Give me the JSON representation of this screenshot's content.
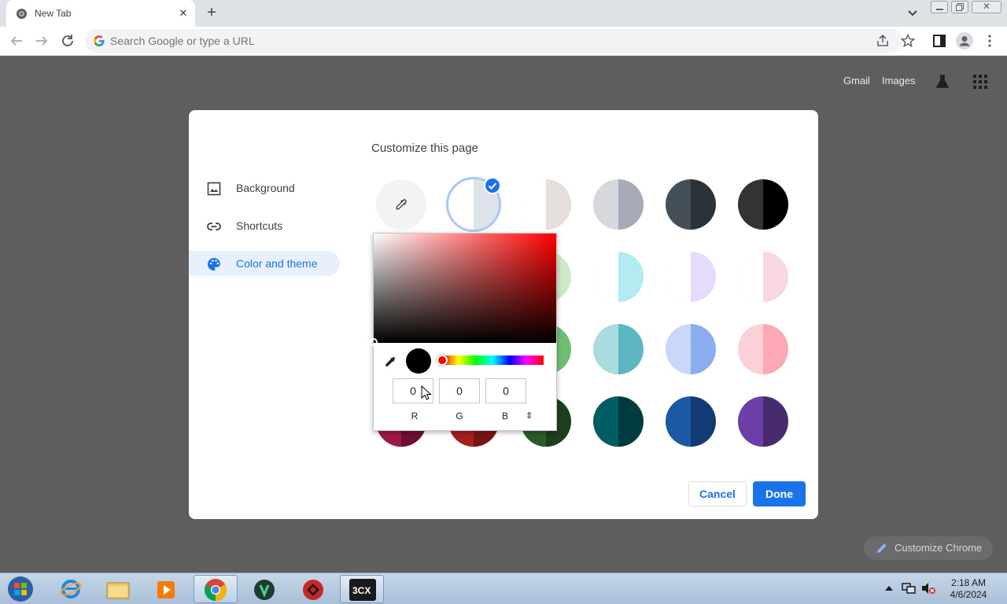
{
  "browser": {
    "tab_title": "New Tab",
    "omnibox_placeholder": "Search Google or type a URL"
  },
  "ntp": {
    "links": [
      "Gmail",
      "Images"
    ],
    "customize_chrome_label": "Customize Chrome"
  },
  "dialog": {
    "title": "Customize this page",
    "menu": [
      {
        "label": "Background",
        "icon": "image-icon"
      },
      {
        "label": "Shortcuts",
        "icon": "link-icon"
      },
      {
        "label": "Color and theme",
        "icon": "palette-icon",
        "selected": true
      }
    ],
    "swatches": [
      {
        "l": "#f1f3f4",
        "r": "#f1f3f4",
        "icon": "eyedropper-icon"
      },
      {
        "l": "#ffffff",
        "r": "#dee3e8",
        "selected": true
      },
      {
        "l": "#ffffff",
        "r": "#e6dedb"
      },
      {
        "l": "#d6d8dd",
        "r": "#a6abb7"
      },
      {
        "l": "#454f58",
        "r": "#2b3338"
      },
      {
        "l": "#333333",
        "r": "#000000"
      },
      {
        "l": "#ffffff",
        "r": "#cfe8c8"
      },
      {
        "l": "#ffffff",
        "r": "#cfe8c8"
      },
      {
        "l": "#ffffff",
        "r": "#cfe8c8"
      },
      {
        "l": "#ffffff",
        "r": "#b2ebf2"
      },
      {
        "l": "#ffffff",
        "r": "#e7dbfb"
      },
      {
        "l": "#ffffff",
        "r": "#f8d6e3"
      },
      {
        "l": "#fcc9d3",
        "r": "#ff9aa9"
      },
      {
        "l": "#f0b1ae",
        "r": "#e57373"
      },
      {
        "l": "#a6d9a2",
        "r": "#6fbf73"
      },
      {
        "l": "#a8dcde",
        "r": "#5cb7c3"
      },
      {
        "l": "#c9d8f8",
        "r": "#8aadf0"
      },
      {
        "l": "#fbd0d7",
        "r": "#ffa8b5"
      },
      {
        "l": "#9c1948",
        "r": "#6d0f33"
      },
      {
        "l": "#a5201f",
        "r": "#7a1414"
      },
      {
        "l": "#2a5b2c",
        "r": "#1c3f1e"
      },
      {
        "l": "#005d63",
        "r": "#003b40"
      },
      {
        "l": "#1b59a5",
        "r": "#123b73"
      },
      {
        "l": "#6b3fa7",
        "r": "#472b6d"
      }
    ],
    "picker": {
      "r": "0",
      "g": "0",
      "b": "0",
      "r_label": "R",
      "g_label": "G",
      "b_label": "B",
      "toggle_glyph": "⇕"
    },
    "cancel_label": "Cancel",
    "done_label": "Done"
  },
  "taskbar": {
    "apps": [
      "start-orb",
      "internet-explorer",
      "file-explorer",
      "media-player",
      "google-chrome",
      "vpn-app",
      "security-app",
      "3cx-app"
    ],
    "app_3cx_text": "3CX",
    "time": "2:18 AM",
    "date": "4/6/2024"
  }
}
